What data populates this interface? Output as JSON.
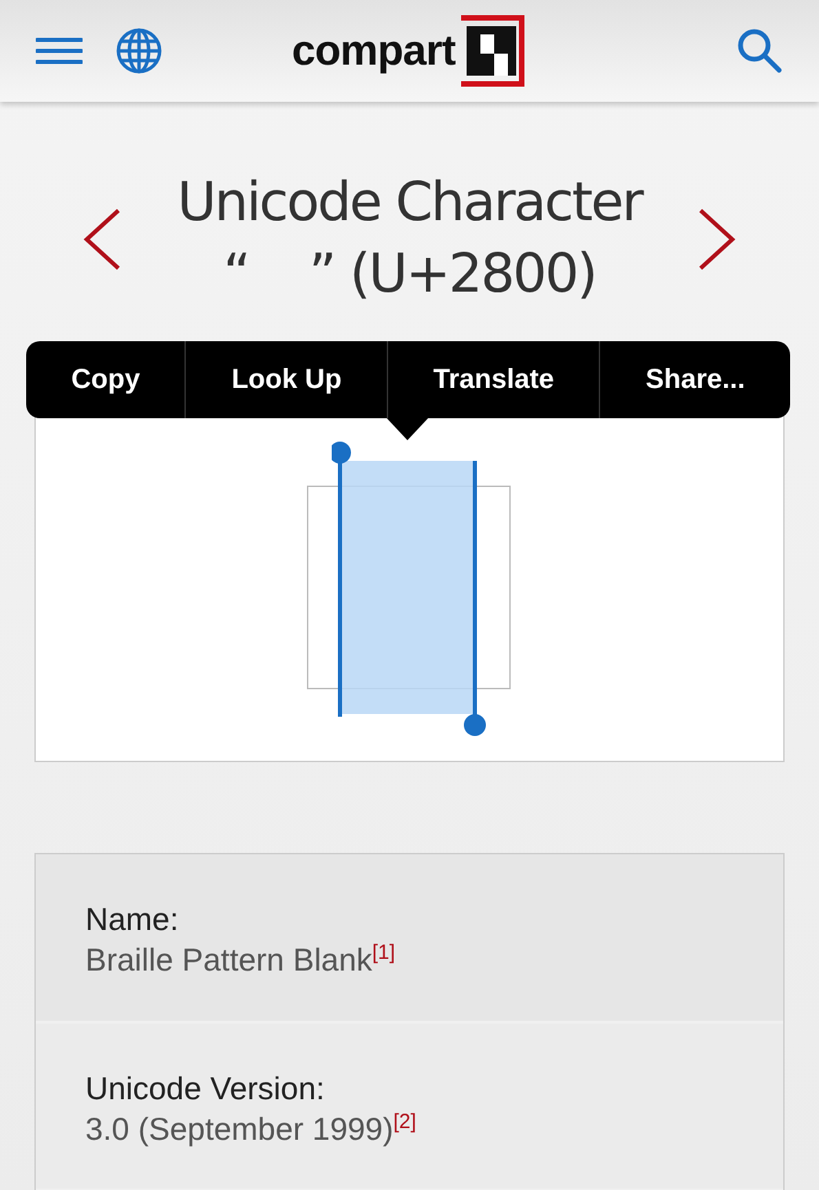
{
  "header": {
    "logo": "compart"
  },
  "title": {
    "line_1": "Unicode Character",
    "line_2": "“    ” (U+2800)"
  },
  "context_menu": [
    "Copy",
    "Look Up",
    "Translate",
    "Share..."
  ],
  "properties": [
    {
      "label": "Name:",
      "value": "Braille Pattern Blank$^{[1]}$"
    },
    {
      "label": "Unicode Version:",
      "value": "3.0 (September 1999)$^{[2]}$"
    }
  ]
}
